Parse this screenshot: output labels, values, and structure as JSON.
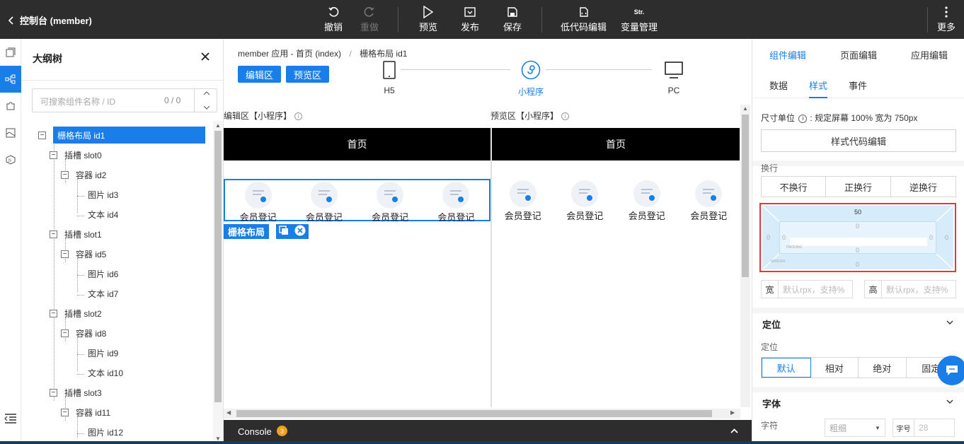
{
  "topbar": {
    "back_label": "控制台 (member)",
    "buttons": [
      {
        "label": "撤销",
        "icon": "undo-icon"
      },
      {
        "label": "重做",
        "icon": "redo-icon"
      },
      {
        "label": "预览",
        "icon": "play-icon"
      },
      {
        "label": "发布",
        "icon": "publish-icon"
      },
      {
        "label": "保存",
        "icon": "save-icon"
      },
      {
        "label": "低代码编辑",
        "icon": "code-file-icon"
      },
      {
        "label": "变量管理",
        "icon_text": "Str."
      },
      {
        "label": "更多",
        "icon": "more-vertical-icon"
      }
    ]
  },
  "outline": {
    "title": "大纲树",
    "search_placeholder": "可搜索组件名称 / ID",
    "search_count": "0 / 0",
    "nodes": [
      "栅格布局 id1",
      "插槽 slot0",
      "容器 id2",
      "图片 id3",
      "文本 id4",
      "插槽 slot1",
      "容器 id5",
      "图片 id6",
      "文本 id7",
      "插槽 slot2",
      "容器 id8",
      "图片 id9",
      "文本 id10",
      "插槽 slot3",
      "容器 id11",
      "图片 id12"
    ]
  },
  "center": {
    "breadcrumb": [
      "member 应用 - 首页 (index)",
      "/",
      "栅格布局 id1"
    ],
    "edit_btn": "编辑区",
    "preview_btn": "预览区",
    "devices": [
      "H5",
      "小程序",
      "PC"
    ],
    "edit_label": "编辑区【小程序】",
    "preview_label": "预览区【小程序】",
    "page_title": "首页",
    "cell_label": "会员登记",
    "tag_label": "栅格布局",
    "console_label": "Console",
    "console_count": "3"
  },
  "right": {
    "tabs": [
      "组件编辑",
      "页面编辑",
      "应用编辑"
    ],
    "subtabs": [
      "数据",
      "样式",
      "事件"
    ],
    "unit_label": "尺寸单位",
    "unit_text": "规定屏幕 100% 宽为 750px",
    "code_btn": "样式代码编辑",
    "wrap_label": "换行",
    "wrap_options": [
      "不换行",
      "正换行",
      "逆换行"
    ],
    "box": {
      "margin_top": "50",
      "padding_top": "0",
      "padding_bottom": "0",
      "margin_bottom": "0",
      "margin_left": "0",
      "padding_left": "0",
      "padding_right": "0",
      "margin_right": "0",
      "padding_tag": "PADDING",
      "margin_tag": "MARGIN"
    },
    "width_key": "宽",
    "width_placeholder": "默认rpx，支持%",
    "height_key": "高",
    "height_placeholder": "默认rpx，支持%",
    "position_section": "定位",
    "position_label": "定位",
    "position_options": [
      "默认",
      "相对",
      "绝对",
      "固定"
    ],
    "font_section": "字体",
    "font_label": "字符",
    "weight_placeholder": "粗细",
    "size_key": "字号",
    "size_value": "28"
  },
  "colors": {
    "accent": "#1a7ee8",
    "topbar": "#2d2d2d",
    "highlight": "#e03a3a"
  }
}
